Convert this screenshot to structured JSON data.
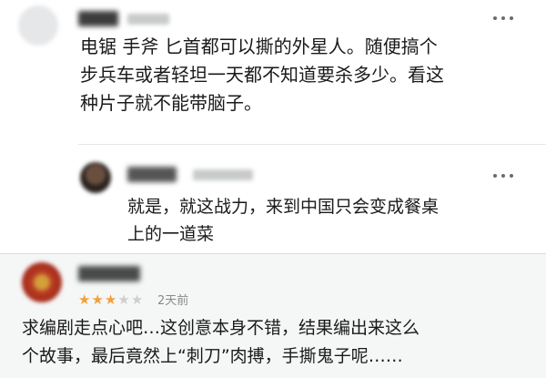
{
  "colors": {
    "star_filled": "#f1a13b",
    "star_empty": "#cfcfcf",
    "meta_text": "#8a8a8a",
    "bottom_panel_bg": "#f5f6f6"
  },
  "comment": {
    "lines": [
      "电锯 手斧  匕首都可以撕的外星人。随便搞个",
      "步兵车或者轻坦一天都不知道要杀多少。看这",
      "种片子就不能带脑子。"
    ],
    "more_icon": "more-dots-icon"
  },
  "reply": {
    "lines": [
      "就是，就这战力，来到中国只会变成餐桌",
      "上的一道菜"
    ],
    "more_icon": "more-dots-icon"
  },
  "review": {
    "rating": 3,
    "rating_max": 5,
    "date": "2天前",
    "lines": [
      "求编剧走点心吧…这创意本身不错，结果编出来这么",
      "个故事，最后竟然上“刺刀”肉搏，手撕鬼子呢……"
    ],
    "more_icon": "more-dots-icon"
  }
}
